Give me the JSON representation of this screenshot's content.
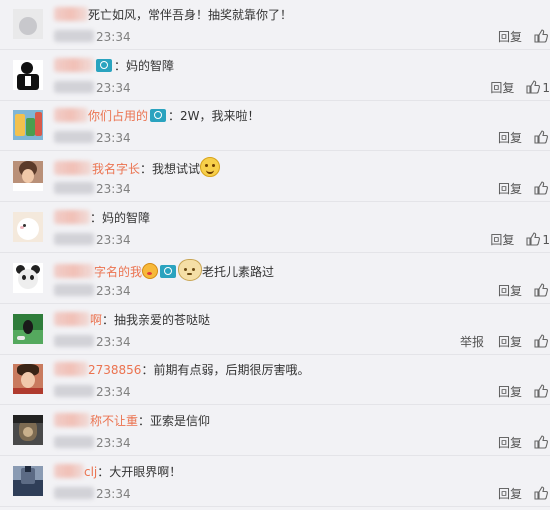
{
  "comments": [
    {
      "name_tail": "",
      "text": "死亡如风，常伴吾身！抽奖就靠你了！",
      "time": "23:34",
      "report": "",
      "reply": "回复",
      "likes": ""
    },
    {
      "name_tail": "",
      "camera": true,
      "text": "：妈的智障",
      "time": "23:34",
      "report": "",
      "reply": "回复",
      "likes": "1"
    },
    {
      "name_tail": "你们占用的",
      "camera": true,
      "text": "：2W，我来啦！",
      "time": "23:34",
      "report": "",
      "reply": "回复",
      "likes": ""
    },
    {
      "name_tail": "我名字长",
      "text": "：我想试试",
      "emoji": "smile",
      "time": "23:34",
      "report": "",
      "reply": "回复",
      "likes": ""
    },
    {
      "name_tail": "",
      "text": "：妈的智障",
      "time": "23:34",
      "report": "",
      "reply": "回复",
      "likes": "1"
    },
    {
      "name_tail": "字名的我",
      "kiss": true,
      "camera": true,
      "text": "",
      "cat": true,
      "text_after": "老托儿素路过",
      "time": "23:34",
      "report": "",
      "reply": "回复",
      "likes": ""
    },
    {
      "name_tail": "啊",
      "text": "：抽我亲爱的苍哒哒",
      "time": "23:34",
      "report": "举报",
      "reply": "回复",
      "likes": ""
    },
    {
      "name_tail": "2738856",
      "text": "：前期有点弱，后期很厉害哦。",
      "time": "23:34",
      "report": "",
      "reply": "回复",
      "likes": ""
    },
    {
      "name_tail": "称不让重",
      "text": "：亚索是信仰",
      "time": "23:34",
      "report": "",
      "reply": "回复",
      "likes": ""
    },
    {
      "name_tail": "clj",
      "text": "：大开眼界啊！",
      "time": "23:34",
      "report": "",
      "reply": "回复",
      "likes": ""
    }
  ],
  "icons": {
    "like": "thumbs-up-icon",
    "camera": "camera-icon"
  },
  "colors": {
    "name": "#eb7350",
    "background": "#f2f2f5",
    "camera": "#2aa3bf"
  }
}
